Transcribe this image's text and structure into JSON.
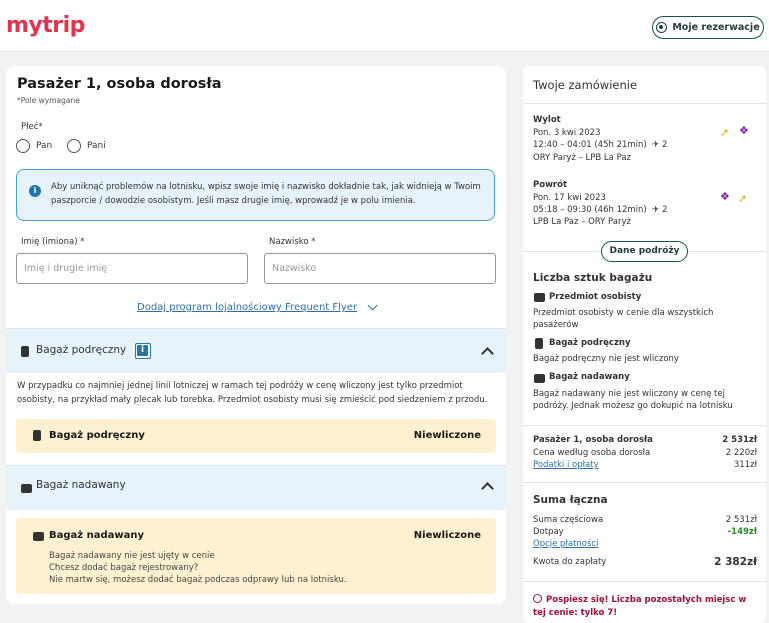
{
  "header": {
    "logo": "mytrip",
    "reservations_button": "Moje rezerwacje"
  },
  "passenger": {
    "title": "Pasażer 1, osoba dorosła",
    "required_note": "*Pole wymagane",
    "gender_label": "Płeć*",
    "gender_options": [
      "Pan",
      "Pani"
    ],
    "info_text": "Aby uniknąć problemów na lotnisku, wpisz swoje imię i nazwisko dokładnie tak, jak widnieją w Twoim paszporcie / dowodzie osobistym. Jeśli masz drugie imię, wprowadź je w polu imienia.",
    "first_name_label": "Imię (imiona) *",
    "first_name_placeholder": "Imię i drugie imię",
    "last_name_label": "Nazwisko *",
    "last_name_placeholder": "Nazwisko",
    "loyalty_link": "Dodaj program lojalnościowy Frequent Flyer"
  },
  "cabin_bag": {
    "section_title": "Bagaż podręczny",
    "description": "W przypadku co najmniej jednej linii lotniczej w ramach tej podróży w cenę wliczony jest tylko przedmiot osobisty, na przykład mały plecak lub torebka. Przedmiot osobisty musi się zmieścić pod siedzeniem z przodu.",
    "item_label": "Bagaż podręczny",
    "item_status": "Niewliczone"
  },
  "checked_bag": {
    "section_title": "Bagaż nadawany",
    "item_label": "Bagaż nadawany",
    "item_status": "Niewliczone",
    "item_lines": [
      "Bagaż nadawany nie jest ujęty w cenie",
      "Chcesz dodać bagaż rejestrowany?",
      "Nie martw się, możesz dodać bagaż podczas odprawy lub na lotnisku."
    ]
  },
  "order": {
    "title": "Twoje zamówienie",
    "departure": {
      "label": "Wylot",
      "date": "Pon. 3 kwi 2023",
      "time": "12:40 – 04:01 (45h 21min)",
      "stops": "2",
      "route": "ORY Paryż – LPB La Paz"
    },
    "return": {
      "label": "Powrót",
      "date": "Pon. 17 kwi 2023",
      "time": "05:18 – 09:30 (46h 12min)",
      "stops": "2",
      "route": "LPB La Paz – ORY Paryż"
    },
    "trip_details_button": "Dane podróży",
    "baggage_title": "Liczba sztuk bagażu",
    "baggage": [
      {
        "label": "Przedmiot osobisty",
        "desc": "Przedmiot osobisty w cenie dla wszystkich pasażerów"
      },
      {
        "label": "Bagaż podręczny",
        "desc": "Bagaż podręczny nie jest wliczony"
      },
      {
        "label": "Bagaż nadawany",
        "desc": "Bagaż nadawany nie jest wliczony w cenę tej podróży. Jednak możesz go dokupić na lotnisku"
      }
    ],
    "price": {
      "passenger_label": "Pasażer 1, osoba dorosła",
      "passenger_value": "2 531zł",
      "fare_label": "Cena według osoba dorosła",
      "fare_value": "2 220zł",
      "taxes_label": "Podatki i opłaty",
      "taxes_value": "311zł"
    },
    "total": {
      "title": "Suma łączna",
      "subtotal_label": "Suma częściowa",
      "subtotal_value": "2 531zł",
      "surcharge_label": "Dotpay",
      "surcharge_value": "-149zł",
      "payment_options": "Opcje płatności",
      "to_pay_label": "Kwota do zapłaty",
      "to_pay_value": "2 382zł"
    },
    "urgency": "Pospiesz się! Liczba pozostałych miejsc w tej cenie: tylko 7!"
  },
  "colors": {
    "brand": "#e3344f",
    "accent": "#16544c",
    "info_bg": "#e6f3fb",
    "warning_bg": "#fdf1cf",
    "link": "#2f6ea6"
  }
}
